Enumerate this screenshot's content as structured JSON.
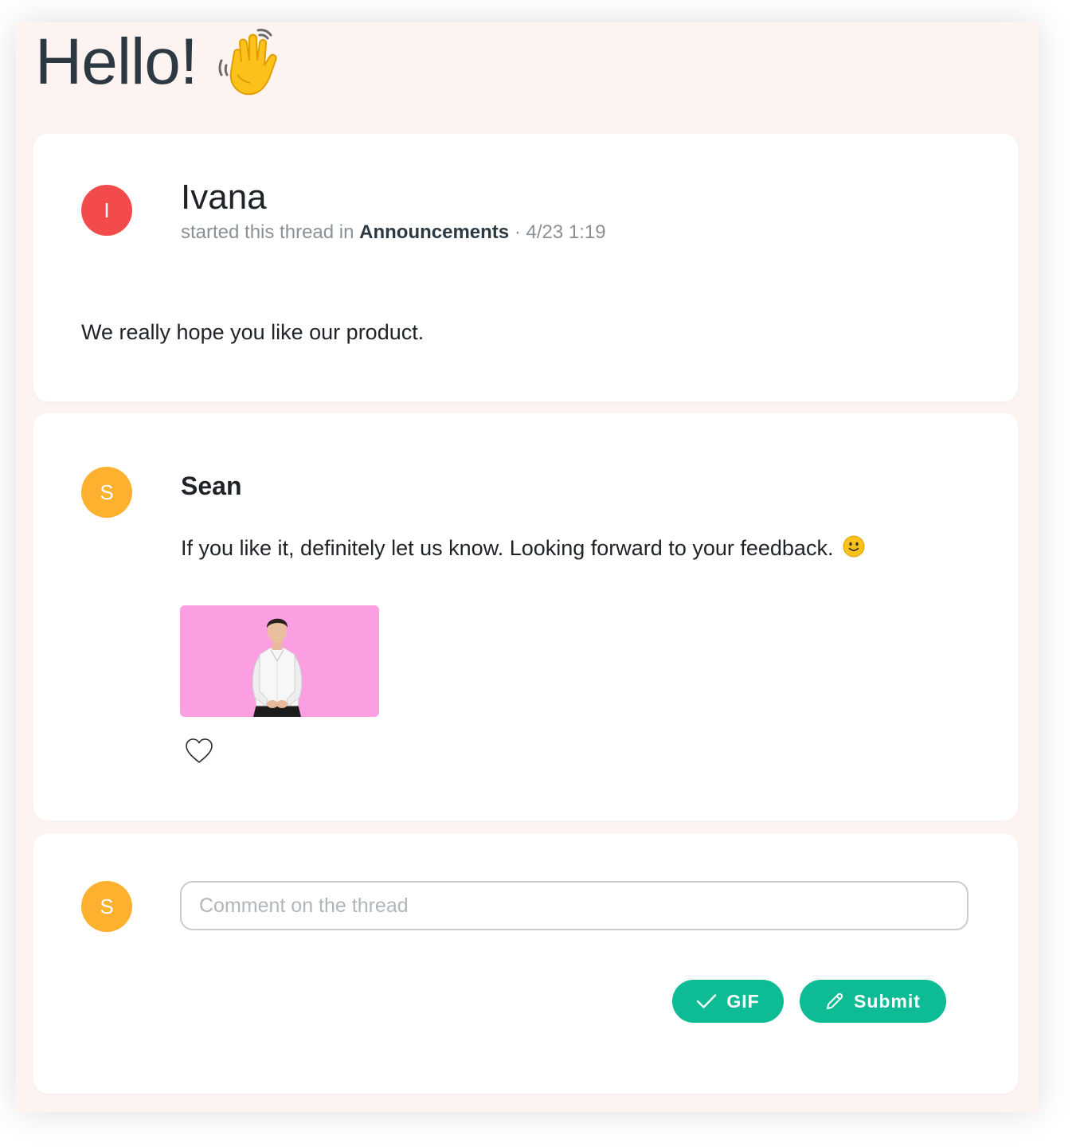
{
  "greeting": {
    "title": "Hello!",
    "emoji_icon": "waving-hand-icon"
  },
  "thread": {
    "starter": {
      "avatar_initial": "I",
      "avatar_color": "#f34b4b",
      "name": "Ivana",
      "meta_prefix": "started this thread in",
      "channel": "Announcements",
      "separator": "·",
      "timestamp": "4/23 1:19",
      "message": "We really hope you like our product."
    },
    "reply": {
      "avatar_initial": "S",
      "avatar_color": "#fdb12f",
      "name": "Sean",
      "message": "If you like it, definitely let us know. Looking forward to your feedback.",
      "emoji_icon": "slightly-smiling-face-icon",
      "attachment_icon": "gif-thumbnail-man-in-white-shirt",
      "attachment_bg": "#fc9ee2",
      "like_icon": "heart-outline-icon"
    }
  },
  "composer": {
    "avatar_initial": "S",
    "avatar_color": "#fdb12f",
    "placeholder": "Comment on the thread",
    "gif_label": "GIF",
    "submit_label": "Submit",
    "button_color": "#0dbb95"
  }
}
